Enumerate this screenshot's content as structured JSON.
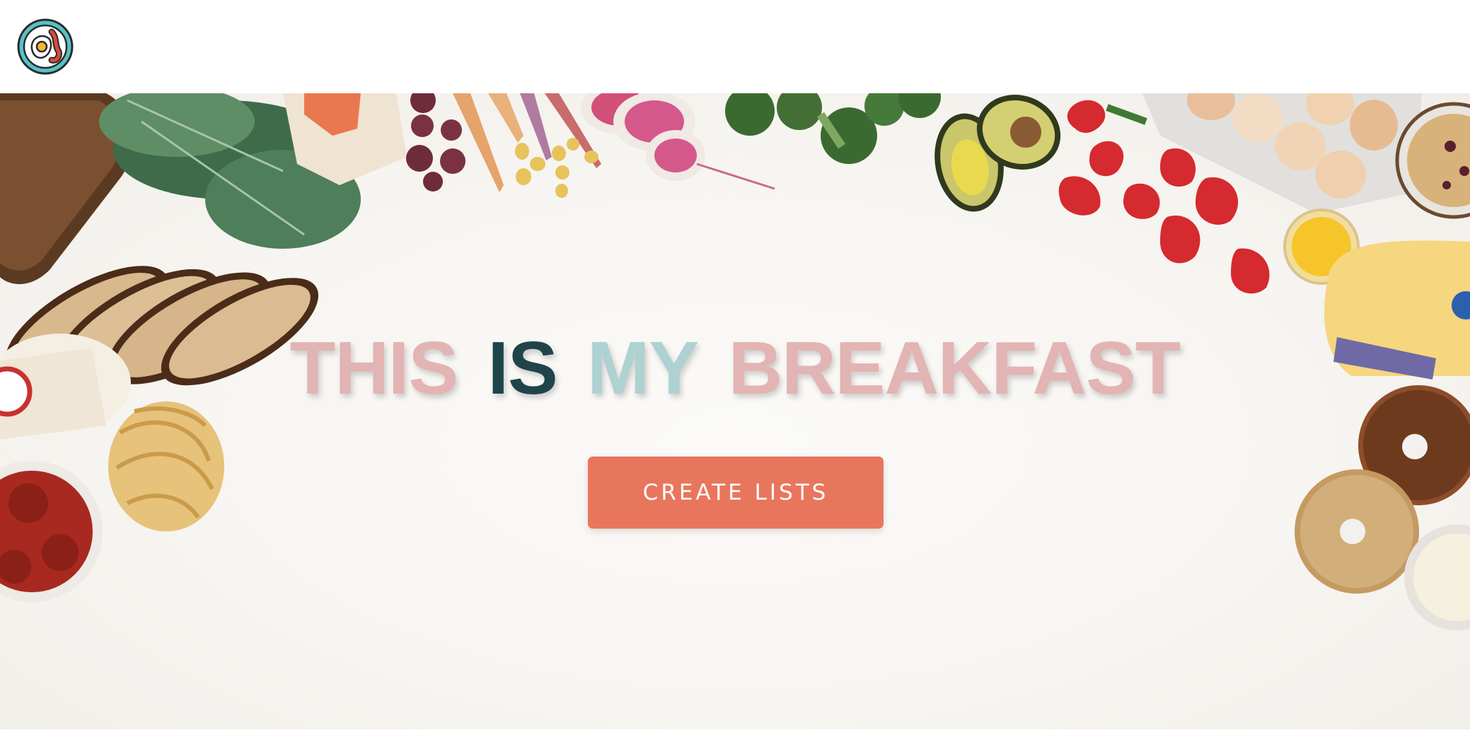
{
  "logo": {
    "icon": "fried-egg-bacon-logo-icon",
    "ring_color": "#55c3c6",
    "ink_color": "#2a2a2a"
  },
  "hero": {
    "headline": [
      {
        "text": "THIS",
        "color": "#e2b4b3"
      },
      {
        "text": "IS",
        "color": "#1f454b"
      },
      {
        "text": "MY",
        "color": "#aed1d2"
      },
      {
        "text": "BREAKFAST",
        "color": "#e2b4b3"
      }
    ],
    "cta": {
      "label": "CREATE LISTS",
      "background": "#e8765d",
      "text_color": "#ffffff"
    }
  },
  "decorations": [
    "sourdough-bread",
    "kale-leaves",
    "salmon-fillet",
    "beets",
    "carrots",
    "baby-potatoes",
    "radish-slices",
    "broccoli",
    "avocado",
    "strawberries",
    "eggs-carton",
    "granola-yogurt",
    "orange-juice-glass",
    "orange-juice-jug",
    "milk-bottle",
    "tagliatelle-nest",
    "meatballs-in-sauce",
    "bagels",
    "cream-cheese"
  ]
}
